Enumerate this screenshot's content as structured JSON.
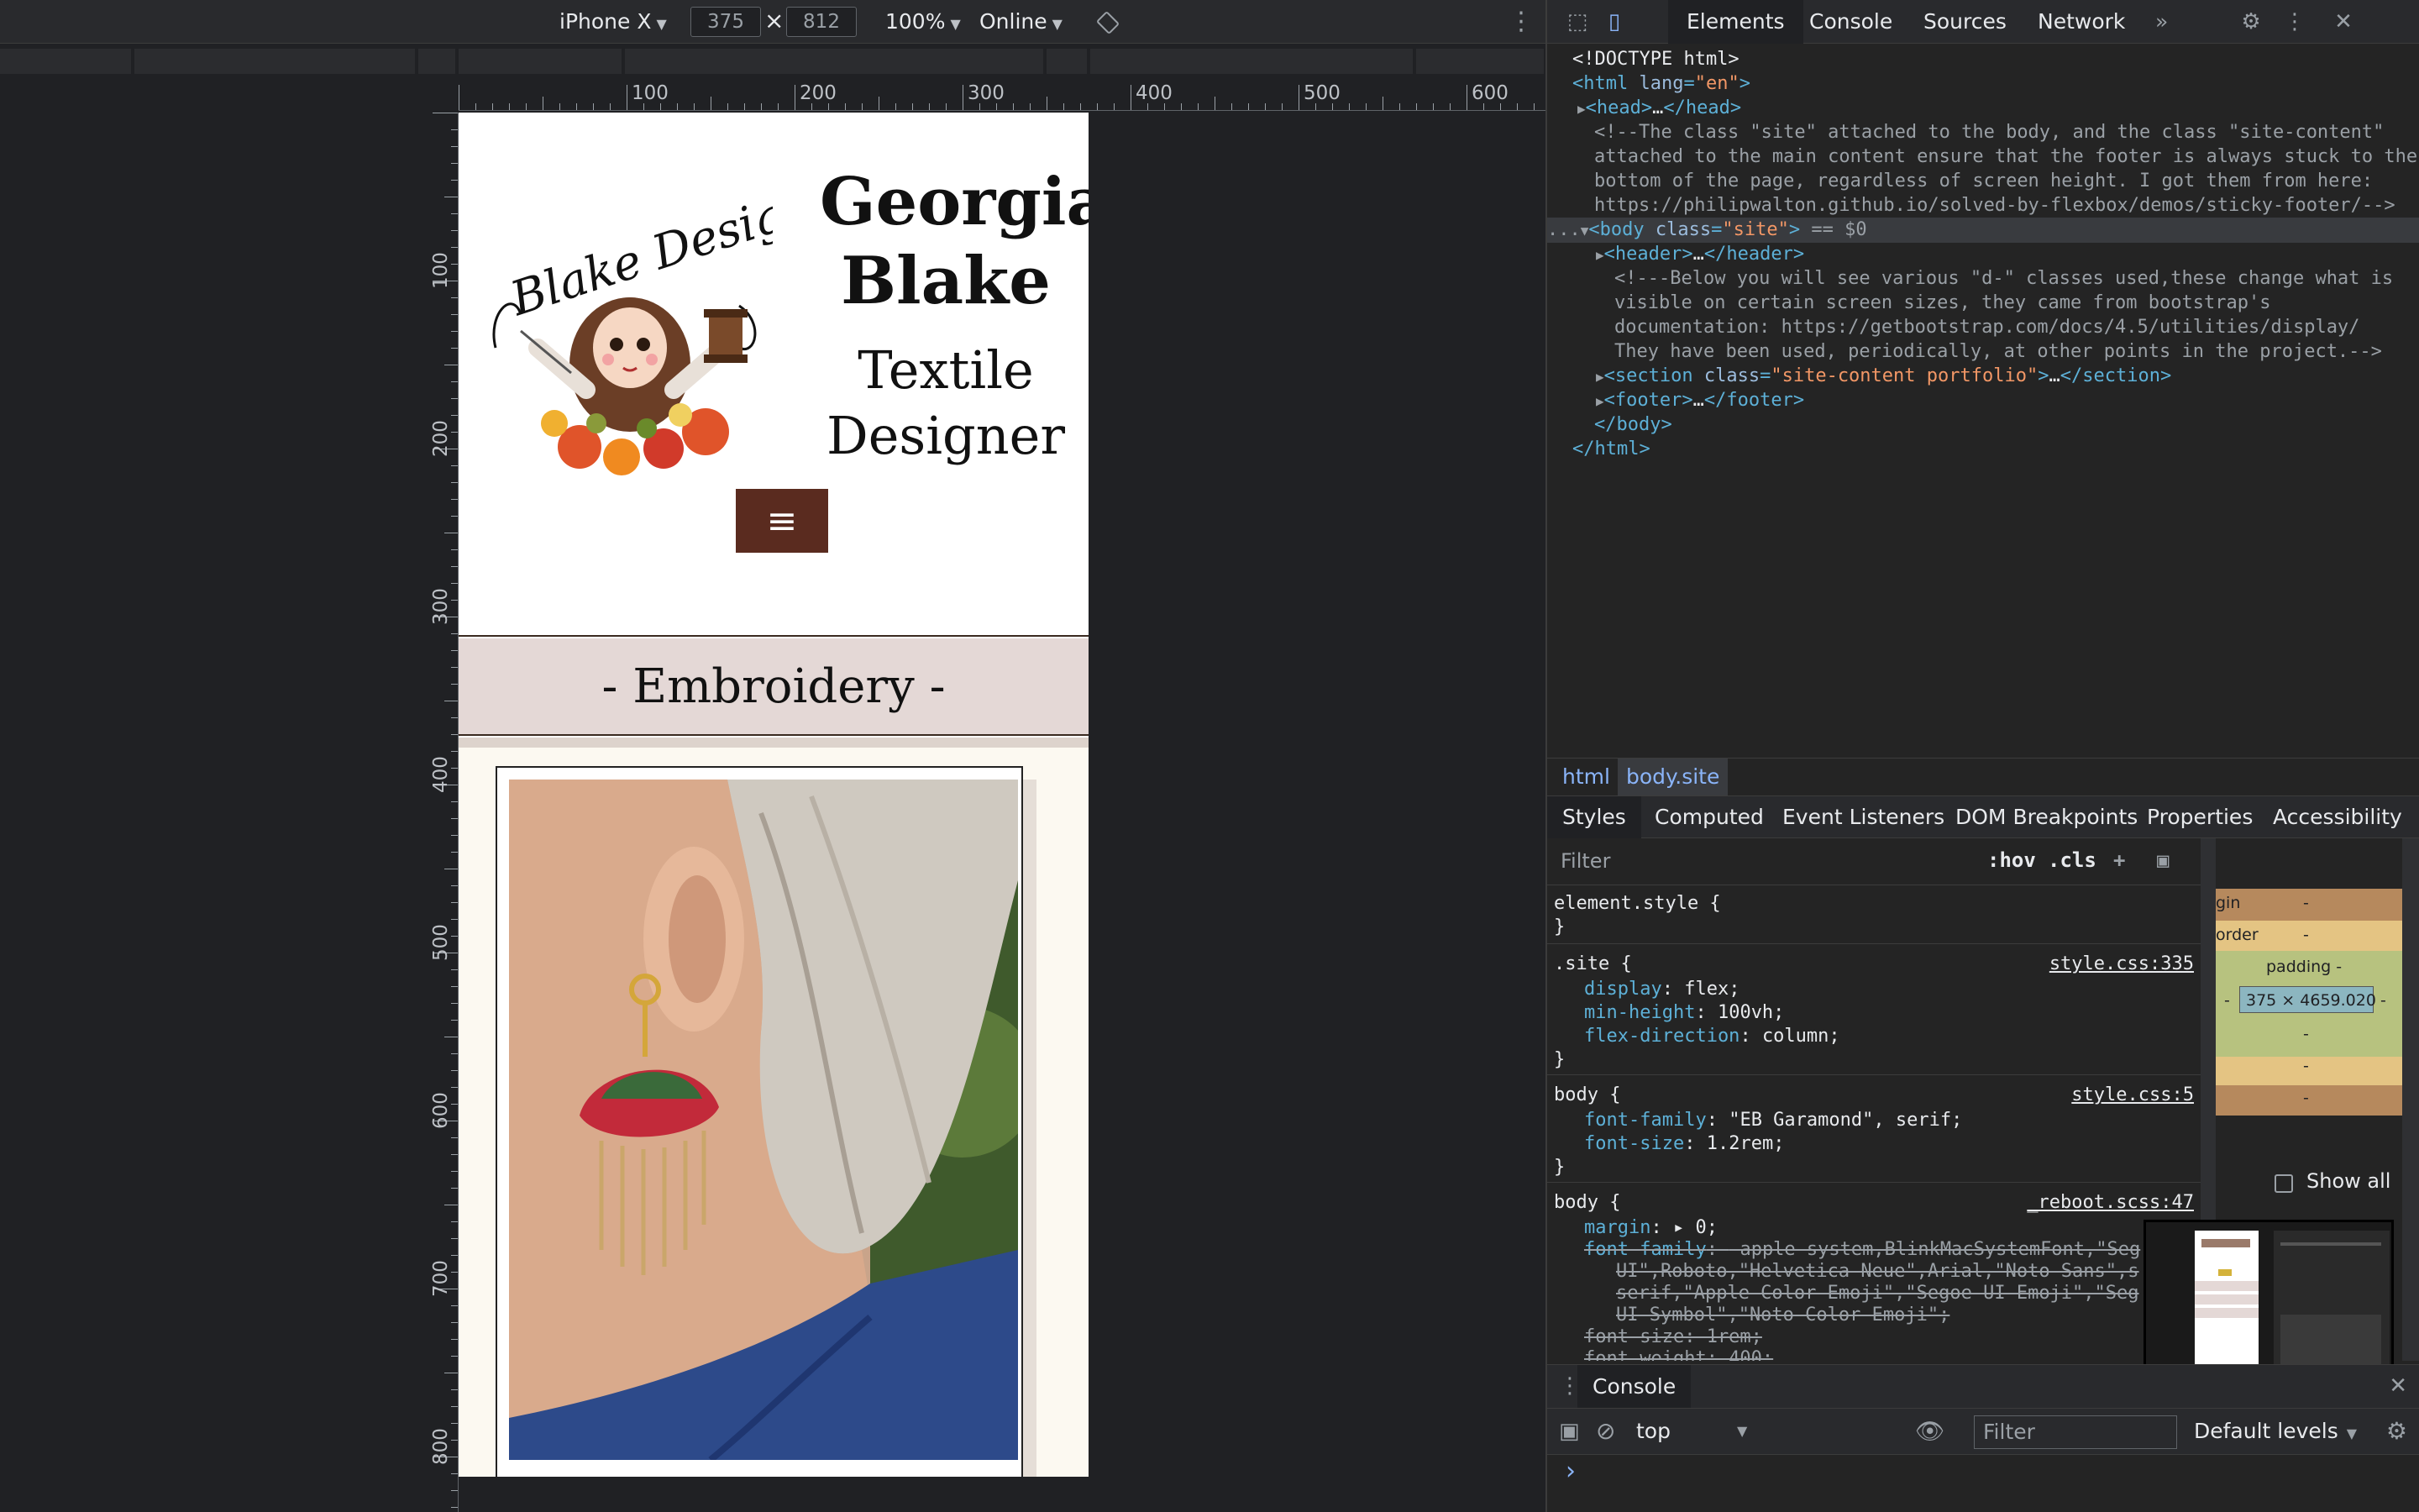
{
  "device_toolbar": {
    "device": "iPhone X",
    "width": "375",
    "height": "812",
    "zoom": "100%",
    "network": "Online",
    "x_symbol": "×"
  },
  "rulers": {
    "h_labels": [
      "100",
      "200",
      "300",
      "400",
      "500",
      "600"
    ],
    "v_labels": [
      "100",
      "200",
      "300",
      "400",
      "500",
      "600",
      "700",
      "800"
    ]
  },
  "site": {
    "logo_text": "Blake Designs",
    "name": "Georgia Blake",
    "tagline": "Textile Designer",
    "menu_icon": "≡",
    "section_title": "- Embroidery -",
    "brand_color": "#5a2b1f",
    "band_color": "#e4d8d6"
  },
  "devtools": {
    "tabs": [
      "Elements",
      "Console",
      "Sources",
      "Network"
    ],
    "more": "»",
    "dom": {
      "doctype": "<!DOCTYPE html>",
      "html_open_tag": "html",
      "lang_attr": "lang",
      "lang_val": "\"en\"",
      "head": "head",
      "comment1": "<!--The class \"site\" attached to the body, and the class \"site-content\"",
      "comment2": "attached to the main content ensure that the footer is always stuck to the",
      "comment3": "bottom of the page, regardless of screen height. I got them from here:",
      "comment4": "https://philipwalton.github.io/solved-by-flexbox/demos/sticky-footer/-->",
      "body_tag": "body",
      "body_attr": "class",
      "body_val": "\"site\"",
      "body_suffix": " == $0",
      "header": "header",
      "c2_1": "<!---Below you will see various \"d-\" classes used,these change what is",
      "c2_2": "visible on certain screen sizes, they came from bootstrap's",
      "c2_3": "documentation: https://getbootstrap.com/docs/4.5/utilities/display/",
      "c2_4": "They have been used, periodically, at other points in the project.-->",
      "section": "section",
      "section_attr": "class",
      "section_val": "\"site-content portfolio\"",
      "footer": "footer",
      "body_close": "</body>",
      "html_close": "</html>",
      "ellipsis": "…",
      "dots": "..."
    },
    "breadcrumbs": [
      "html",
      "body.site"
    ],
    "style_tabs": [
      "Styles",
      "Computed",
      "Event Listeners",
      "DOM Breakpoints",
      "Properties",
      "Accessibility"
    ],
    "filter_placeholder": "Filter",
    "hov": ":hov",
    "cls": ".cls",
    "plus": "+",
    "rules": {
      "element_style": "element.style {",
      "close": "}",
      "site_sel": ".site {",
      "site_src": "style.css:335",
      "site_p1_name": "display",
      "site_p1_val": "flex;",
      "site_p2_name": "min-height",
      "site_p2_val": "100vh;",
      "site_p3_name": "flex-direction",
      "site_p3_val": "column;",
      "body_sel": "body {",
      "body_src": "style.css:5",
      "body_p1_name": "font-family",
      "body_p1_val": "\"EB Garamond\", serif;",
      "body_p2_name": "font-size",
      "body_p2_val": "1.2rem;",
      "reboot_sel": "body {",
      "reboot_src": "_reboot.scss:47",
      "reboot_p1_name": "margin",
      "reboot_p1_val": "▸ 0;",
      "reboot_ff_name": "font-family",
      "reboot_ff_1": "-apple-system,BlinkMacSystemFont,\"Seg",
      "reboot_ff_2": "UI\",Roboto,\"Helvetica Neue\",Arial,\"Noto Sans\",s",
      "reboot_ff_3": "serif,\"Apple Color Emoji\",\"Segoe UI Emoji\",\"Seg",
      "reboot_ff_4": "UI Symbol\",\"Noto Color Emoji\";",
      "reboot_fs": "font-size: 1rem;",
      "reboot_fw": "font-weight: 400;"
    },
    "boxmodel": {
      "margin": "gin",
      "margin_val": "-",
      "border": "order",
      "border_val": "-",
      "padding": "padding -",
      "content": "375 × 4659.020",
      "dash": "-"
    },
    "show_all": "Show all",
    "console": {
      "tab": "Console",
      "context": "top",
      "filter": "Filter",
      "levels": "Default levels",
      "prompt": "›"
    }
  }
}
